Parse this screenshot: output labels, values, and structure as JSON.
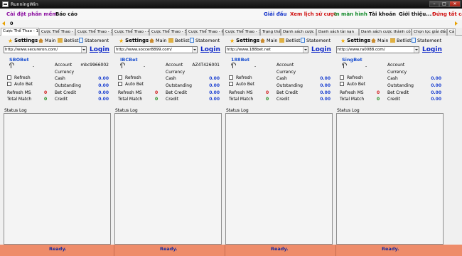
{
  "window": {
    "title": "RunningWin"
  },
  "menu": {
    "left": [
      "Cài đặt phần mềm",
      "Báo cáo"
    ],
    "right": [
      "Giải đấu",
      "Xem lịch sử cược",
      "In màn hình",
      "Tài khoản",
      "Giới thiệu...",
      "Đứng tất cả"
    ],
    "colors": {
      "purple": "#8b0fa0",
      "blue": "#1030c8",
      "green": "#128a2a",
      "dark": "#111111",
      "red": "#d01010"
    }
  },
  "toolbar": {
    "counter": "0"
  },
  "tabs": [
    "Cược Thể Thao - 1",
    "Cược Thể Thao - 2",
    "Cược Thể Thao - 3",
    "Cược Thể Thao - 4",
    "Cược Thể Thao - 5",
    "Cược Thể Thao - 6",
    "Cược Thể Thao - 7",
    "Trạng thái",
    "Danh sách cược",
    "Danh sách tài nạn",
    "Danh sách cược thành công",
    "Chọn lọc giải đấu",
    "Cả"
  ],
  "panel_toolbar": {
    "settings": "Settings",
    "main": "Main",
    "betlist": "Betlist",
    "statement": "Statement"
  },
  "panel_labels": {
    "login": "Login",
    "refresh": "Refresh",
    "auto_bet": "Auto Bet",
    "account": "Account",
    "currency": "Currency",
    "cash": "Cash",
    "outstanding": "Outstanding",
    "bet_credit": "Bet Credit",
    "credit": "Credit",
    "refresh_ms": "Refresh MS",
    "total_match": "Total Match",
    "status_log": "Status Log",
    "dash": "-"
  },
  "panels": [
    {
      "url": "http://www.secureron.com/",
      "site": "SBOBet",
      "account": "mbc9966002",
      "cash": "0.00",
      "outstanding": "0.00",
      "bet_credit": "0.00",
      "credit": "0.00",
      "refresh_ms": "0",
      "total_match": "0"
    },
    {
      "url": "http://www.soccer8899.com/",
      "site": "IBCBet",
      "account": "AZ4T426001",
      "cash": "0.00",
      "outstanding": "0.00",
      "bet_credit": "0.00",
      "credit": "0.00",
      "refresh_ms": "0",
      "total_match": "0"
    },
    {
      "url": "http://www.188bet.net",
      "site": "188Bet",
      "account": "",
      "cash": "0.00",
      "outstanding": "0.00",
      "bet_credit": "0.00",
      "credit": "0.00",
      "refresh_ms": "0",
      "total_match": "0"
    },
    {
      "url": "http://www.ra0088.com/",
      "site": "SingBet",
      "account": "",
      "cash": "0.00",
      "outstanding": "0.00",
      "bet_credit": "0.00",
      "credit": "0.00",
      "refresh_ms": "0",
      "total_match": "0"
    }
  ],
  "status": [
    "Ready.",
    "Ready.",
    "Ready.",
    "Ready."
  ]
}
